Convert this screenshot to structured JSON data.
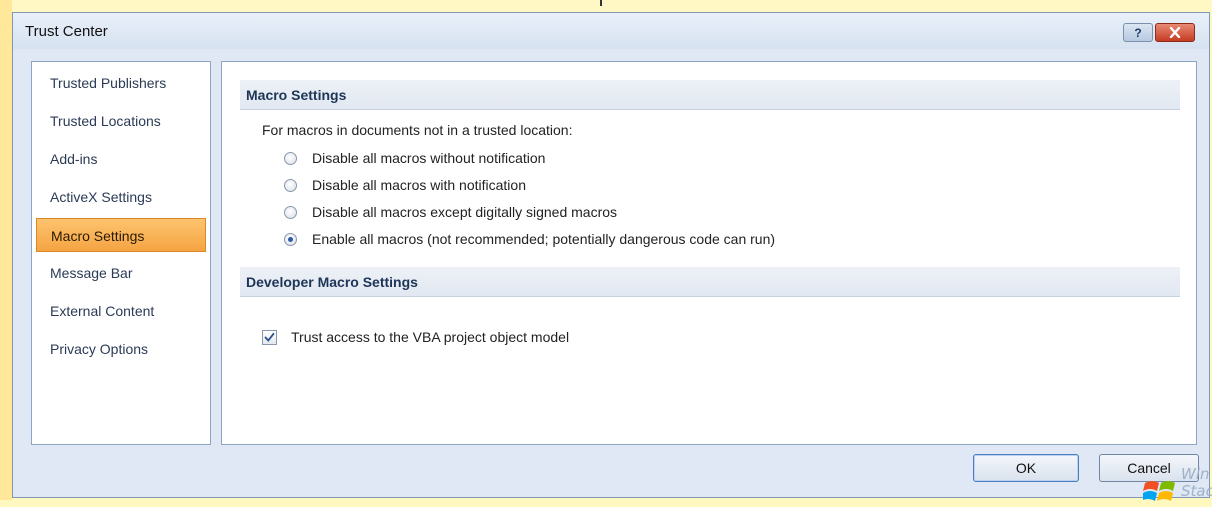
{
  "window": {
    "title": "Trust Center"
  },
  "nav": {
    "items": [
      {
        "label": "Trusted Publishers"
      },
      {
        "label": "Trusted Locations"
      },
      {
        "label": "Add-ins"
      },
      {
        "label": "ActiveX Settings"
      },
      {
        "label": "Macro Settings",
        "selected": true
      },
      {
        "label": "Message Bar"
      },
      {
        "label": "External Content"
      },
      {
        "label": "Privacy Options"
      }
    ]
  },
  "macro_settings": {
    "header": "Macro Settings",
    "description": "For macros in documents not in a trusted location:",
    "options": [
      {
        "label": "Disable all macros without notification",
        "checked": false
      },
      {
        "label": "Disable all macros with notification",
        "checked": false
      },
      {
        "label": "Disable all macros except digitally signed macros",
        "checked": false
      },
      {
        "label": "Enable all macros (not recommended; potentially dangerous code can run)",
        "checked": true
      }
    ]
  },
  "developer_settings": {
    "header": "Developer Macro Settings",
    "vba_access": {
      "label": "Trust access to the VBA project object model",
      "checked": true
    }
  },
  "buttons": {
    "ok": "OK",
    "cancel": "Cancel"
  },
  "watermark": {
    "line1": "Win",
    "line2": "Stac"
  },
  "colors": {
    "selected_nav": "#f5a443",
    "section_header_text": "#1d3557",
    "close_button": "#c43c22"
  },
  "icons": {
    "help": "help-icon",
    "close": "close-icon",
    "check": "checkmark-icon",
    "logo": "windows-logo-icon"
  }
}
